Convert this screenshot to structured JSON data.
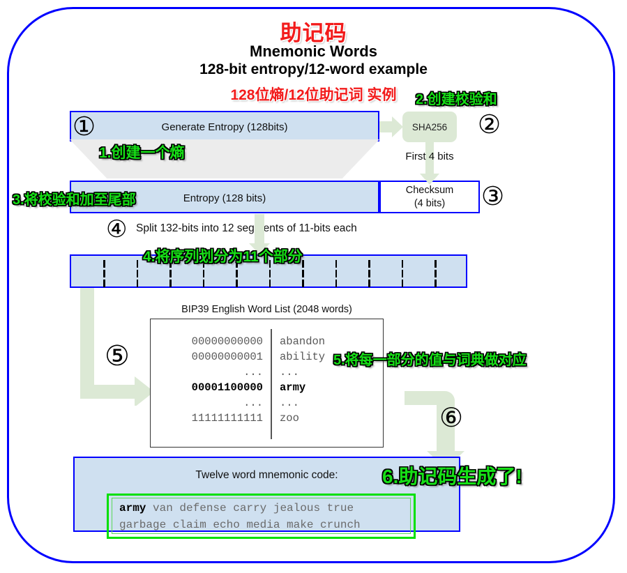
{
  "title": {
    "cn_main": "助记码",
    "en_main": "Mnemonic Words",
    "en_sub": "128-bit entropy/12-word example",
    "cn_sub": "128位熵/12位助记词 实例"
  },
  "annotations": [
    {
      "id": "ann1",
      "text": "1.创建一个熵"
    },
    {
      "id": "ann2",
      "text": "2.创建校验和"
    },
    {
      "id": "ann3",
      "text": "3.将校验和加至尾部"
    },
    {
      "id": "ann4",
      "text": "4.将序列划分为11个部分"
    },
    {
      "id": "ann5",
      "text": "5.将每一部分的值与词典做对应"
    },
    {
      "id": "ann6",
      "text": "6.助记码生成了!"
    }
  ],
  "steps": {
    "one": "①",
    "two": "②",
    "three": "③",
    "four": "④",
    "five": "⑤",
    "six": "⑥"
  },
  "boxes": {
    "generate_entropy": "Generate Entropy (128bits)",
    "sha256": "SHA256",
    "first_4_bits": "First 4 bits",
    "entropy_128": "Entropy (128 bits)",
    "checksum_line1": "Checksum",
    "checksum_line2": "(4 bits)",
    "split_text": "Split 132-bits into 12 segments of 11-bits each"
  },
  "wordlist": {
    "caption": "BIP39 English Word List (2048 words)",
    "rows": [
      {
        "code": "00000000000",
        "word": "abandon",
        "bold": false
      },
      {
        "code": "00000000001",
        "word": "ability",
        "bold": false
      },
      {
        "code": "...",
        "word": "...",
        "bold": false
      },
      {
        "code": "00001100000",
        "word": "army",
        "bold": true
      },
      {
        "code": "...",
        "word": "...",
        "bold": false
      },
      {
        "code": "11111111111",
        "word": "zoo",
        "bold": false
      }
    ]
  },
  "final": {
    "caption": "Twelve word mnemonic code:",
    "first_word": "army",
    "line1_rest": " van defense carry jealous true",
    "line2": "garbage claim echo media make crunch",
    "words": [
      "army",
      "van",
      "defense",
      "carry",
      "jealous",
      "true",
      "garbage",
      "claim",
      "echo",
      "media",
      "make",
      "crunch"
    ]
  },
  "segments": {
    "count": 12,
    "dividers": 11
  },
  "colors": {
    "frame_blue": "#0000ff",
    "box_fill": "#cfe0f0",
    "title_red": "#f21b1b",
    "annotation_green": "#16e016",
    "arrow_green": "#dce9d5",
    "highlight_green": "#00e000",
    "funnel_gray": "#ececec"
  }
}
